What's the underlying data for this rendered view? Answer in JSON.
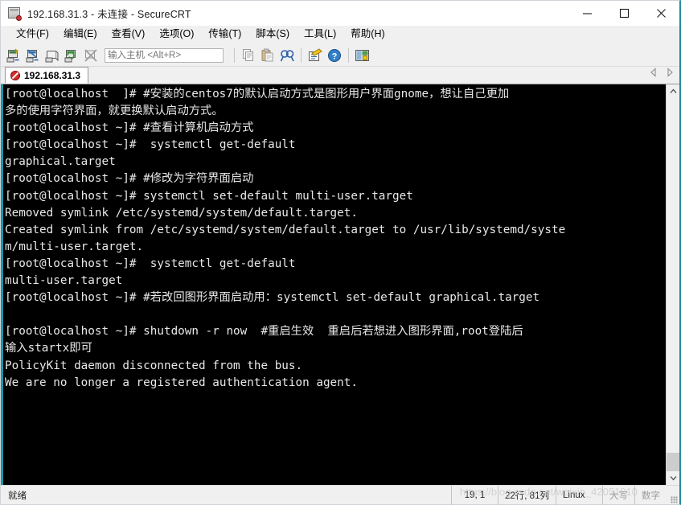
{
  "window": {
    "title": "192.168.31.3 - 未连接 - SecureCRT",
    "app_icon": "securecrt-icon",
    "controls": {
      "minimize": "minimize-icon",
      "maximize": "maximize-icon",
      "close": "close-icon"
    }
  },
  "menubar": {
    "items": [
      {
        "label": "文件(F)"
      },
      {
        "label": "编辑(E)"
      },
      {
        "label": "查看(V)"
      },
      {
        "label": "选项(O)"
      },
      {
        "label": "传输(T)"
      },
      {
        "label": "脚本(S)"
      },
      {
        "label": "工具(L)"
      },
      {
        "label": "帮助(H)"
      }
    ]
  },
  "toolbar": {
    "buttons": [
      {
        "name": "new-session-icon"
      },
      {
        "name": "connect-session-icon"
      },
      {
        "name": "connect-local-shell-icon"
      },
      {
        "name": "reconnect-icon"
      },
      {
        "name": "disconnect-icon"
      },
      {
        "name": "copy-icon"
      },
      {
        "name": "paste-icon"
      },
      {
        "name": "find-icon"
      },
      {
        "name": "session-options-icon"
      },
      {
        "name": "help-icon"
      },
      {
        "name": "session-manager-icon"
      }
    ],
    "host_input": {
      "value": "",
      "placeholder": "输入主机 <Alt+R>"
    }
  },
  "tabbar": {
    "tabs": [
      {
        "label": "192.168.31.3",
        "icon": "disconnected-icon",
        "active": true
      }
    ],
    "scroll_left": "scroll-left-icon",
    "scroll_right": "scroll-right-icon"
  },
  "terminal": {
    "lines": [
      "[root@localhost  ]# #安装的centos7的默认启动方式是图形用户界面gnome，想让自己更加",
      "多的使用字符界面，就更换默认启动方式。",
      "[root@localhost ~]# #查看计算机启动方式",
      "[root@localhost ~]#  systemctl get-default",
      "graphical.target",
      "[root@localhost ~]# #修改为字符界面启动",
      "[root@localhost ~]# systemctl set-default multi-user.target",
      "Removed symlink /etc/systemd/system/default.target.",
      "Created symlink from /etc/systemd/system/default.target to /usr/lib/systemd/syste",
      "m/multi-user.target.",
      "[root@localhost ~]#  systemctl get-default",
      "multi-user.target",
      "[root@localhost ~]# #若改回图形界面启动用：systemctl set-default graphical.target",
      "",
      "[root@localhost ~]# shutdown -r now  #重启生效  重启后若想进入图形界面,root登陆后",
      "输入startx即可",
      "PolicyKit daemon disconnected from the bus.",
      "We are no longer a registered authentication agent.",
      "",
      "",
      "",
      ""
    ],
    "background": "#000000",
    "foreground": "#e8e8e8",
    "accent_border": "#1796a8"
  },
  "scrollbar": {
    "up": "scroll-up-icon",
    "down": "scroll-down-icon",
    "thumb": "scroll-thumb"
  },
  "statusbar": {
    "ready": "就绪",
    "cursor": "19, 1",
    "size": "22行, 81列",
    "emulation": "Linux",
    "caps": "大写",
    "num": "数字",
    "watermark": "https://blog.csdn.net/weixin_42051910"
  }
}
